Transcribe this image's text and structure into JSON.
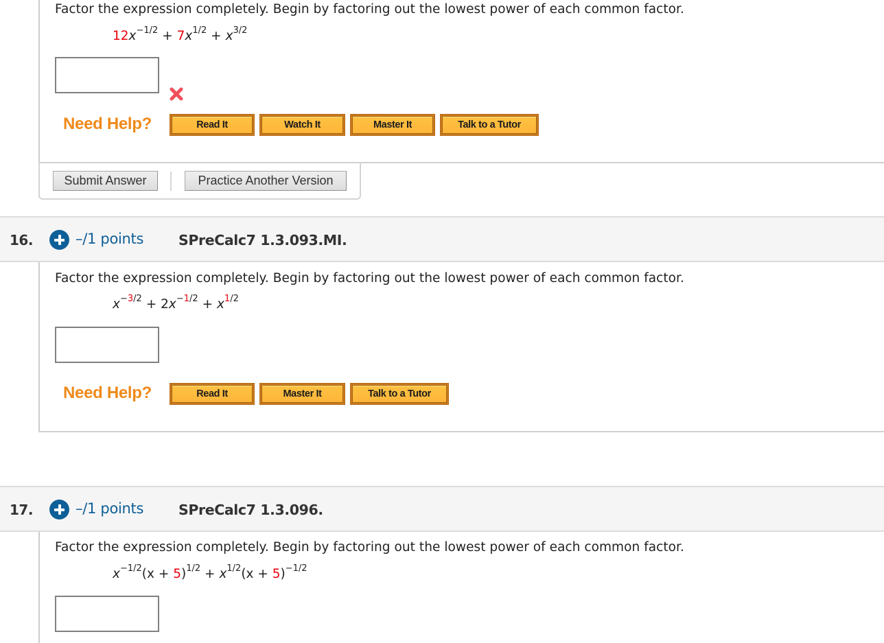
{
  "colors": {
    "accent_blue": "#0e5f97",
    "help_orange": "#ef8a1a",
    "coefficient_red": "#e8000b",
    "wrong_mark": "#f0505a"
  },
  "question15": {
    "instruction": "Factor the expression completely. Begin by factoring out the lowest power of each common factor.",
    "expression": {
      "t1_coef": "12",
      "t1_var": "x",
      "t1_exp": "−1/2",
      "op1": "+",
      "t2_coef": "7",
      "t2_var": "x",
      "t2_exp": "1/2",
      "op2": "+",
      "t3_var": "x",
      "t3_exp": "3/2"
    },
    "answer_value": "",
    "status_icon": "wrong-x-icon",
    "help": {
      "label": "Need Help?",
      "buttons": [
        "Read It",
        "Watch It",
        "Master It",
        "Talk to a Tutor"
      ]
    },
    "submit_label": "Submit Answer",
    "practice_label": "Practice Another Version"
  },
  "question16": {
    "number": "16.",
    "points": "–/1 points",
    "id": "SPreCalc7 1.3.093.MI.",
    "instruction": "Factor the expression completely. Begin by factoring out the lowest power of each common factor.",
    "expression": {
      "t1_var": "x",
      "t1_exp_sign": "−",
      "t1_exp_num": "3",
      "t1_exp_den": "/2",
      "op1": "+",
      "t2_coef": "2",
      "t2_var": "x",
      "t2_exp_sign": "−",
      "t2_exp_num": "1",
      "t2_exp_den": "/2",
      "op2": "+",
      "t3_var": "x",
      "t3_exp_num": "1",
      "t3_exp_den": "/2"
    },
    "answer_value": "",
    "help": {
      "label": "Need Help?",
      "buttons": [
        "Read It",
        "Master It",
        "Talk to a Tutor"
      ]
    }
  },
  "question17": {
    "number": "17.",
    "points": "–/1 points",
    "id": "SPreCalc7 1.3.096.",
    "instruction": "Factor the expression completely. Begin by factoring out the lowest power of each common factor.",
    "expression": {
      "a_var": "x",
      "a_exp": "−1/2",
      "a_open": "(x + ",
      "a_const": "5",
      "a_close": ")",
      "a_pexp": "1/2",
      "op": "+",
      "b_var": "x",
      "b_exp": "1/2",
      "b_open": "(x + ",
      "b_const": "5",
      "b_close": ")",
      "b_pexp": "−1/2"
    },
    "answer_value": ""
  }
}
